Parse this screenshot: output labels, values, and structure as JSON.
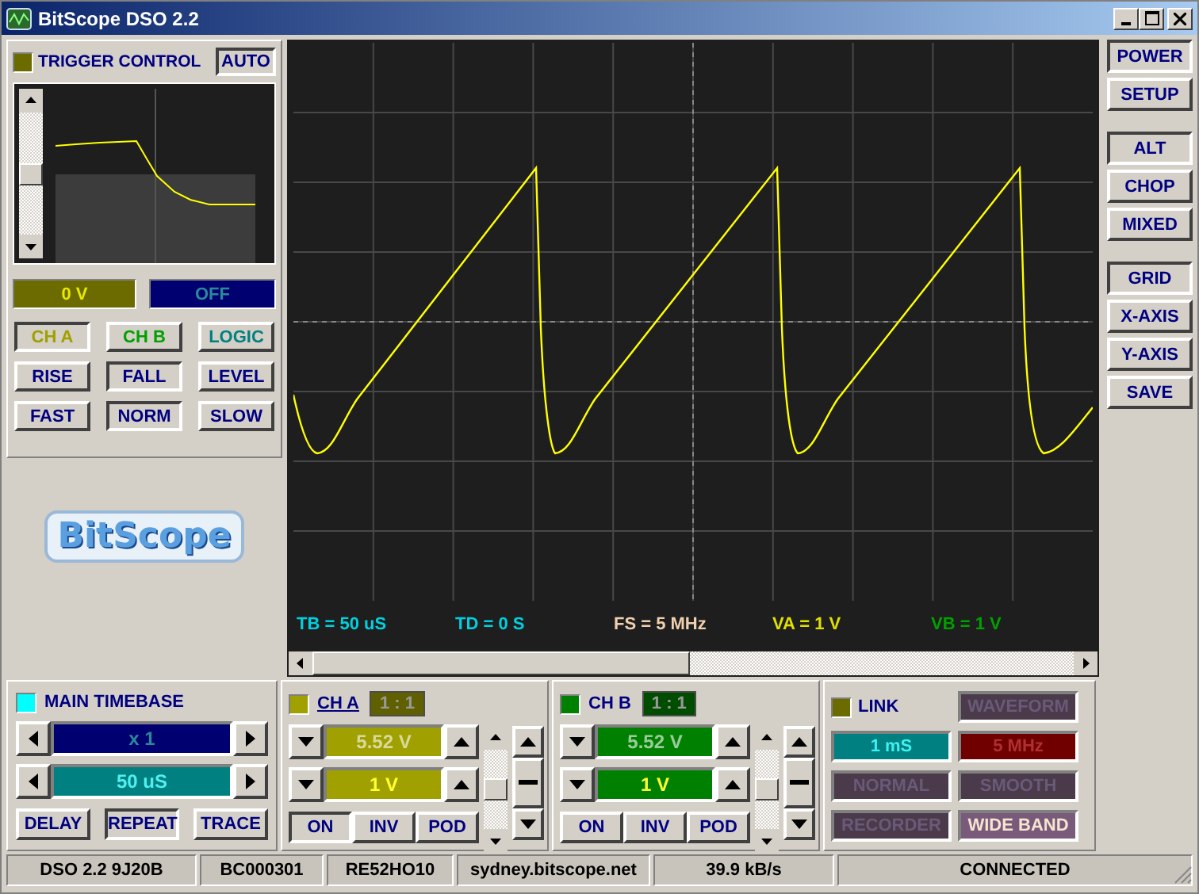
{
  "window": {
    "title": "BitScope DSO 2.2"
  },
  "trigger": {
    "title": "TRIGGER CONTROL",
    "auto": {
      "label": "AUTO",
      "pressed": true
    },
    "level_display": "0 V",
    "mode_display": "OFF",
    "buttons": [
      {
        "label": "CH A",
        "pressed": true,
        "color": "#a0a000"
      },
      {
        "label": "CH B",
        "pressed": false,
        "color": "#00a000"
      },
      {
        "label": "LOGIC",
        "pressed": false,
        "color": "#008080"
      },
      {
        "label": "RISE",
        "pressed": false,
        "color": "#000080"
      },
      {
        "label": "FALL",
        "pressed": true,
        "color": "#000080"
      },
      {
        "label": "LEVEL",
        "pressed": false,
        "color": "#000080"
      },
      {
        "label": "FAST",
        "pressed": false,
        "color": "#000080"
      },
      {
        "label": "NORM",
        "pressed": true,
        "color": "#000080"
      },
      {
        "label": "SLOW",
        "pressed": false,
        "color": "#000080"
      }
    ]
  },
  "logo": "BitScope",
  "scope": {
    "readouts": [
      {
        "text": "TB = 50 uS",
        "color": "#00d0e0"
      },
      {
        "text": "TD = 0 S",
        "color": "#00d0e0"
      },
      {
        "text": "FS = 5 MHz",
        "color": "#f0d0b0"
      },
      {
        "text": "VA = 1 V",
        "color": "#e0e000"
      },
      {
        "text": "VB = 1 V",
        "color": "#00a000"
      }
    ]
  },
  "side_buttons": [
    [
      {
        "label": "POWER",
        "pressed": true
      },
      {
        "label": "SETUP",
        "pressed": false
      }
    ],
    [
      {
        "label": "ALT",
        "pressed": true
      },
      {
        "label": "CHOP",
        "pressed": false
      },
      {
        "label": "MIXED",
        "pressed": false
      }
    ],
    [
      {
        "label": "GRID",
        "pressed": true
      },
      {
        "label": "X-AXIS",
        "pressed": false
      },
      {
        "label": "Y-AXIS",
        "pressed": false
      },
      {
        "label": "SAVE",
        "pressed": false
      }
    ]
  ],
  "timebase": {
    "title": "MAIN TIMEBASE",
    "zoom": "x 1",
    "time": "50 uS",
    "buttons": [
      {
        "label": "DELAY",
        "pressed": false
      },
      {
        "label": "REPEAT",
        "pressed": true
      },
      {
        "label": "TRACE",
        "pressed": false
      }
    ]
  },
  "channels": [
    {
      "name": "CH A",
      "underlined": true,
      "color": "#a0a000",
      "probe": "1 : 1",
      "offset": "5.52 V",
      "range": "1 V",
      "buttons": [
        {
          "label": "ON",
          "pressed": true
        },
        {
          "label": "INV",
          "pressed": false
        },
        {
          "label": "POD",
          "pressed": false
        }
      ]
    },
    {
      "name": "CH B",
      "underlined": false,
      "color": "#008000",
      "probe": "1 : 1",
      "offset": "5.52 V",
      "range": "1 V",
      "buttons": [
        {
          "label": "ON",
          "pressed": false
        },
        {
          "label": "INV",
          "pressed": false
        },
        {
          "label": "POD",
          "pressed": false
        }
      ]
    }
  ],
  "link": {
    "label": "LINK",
    "buttons": [
      {
        "label": "WAVEFORM",
        "kind": "mode",
        "selected": false
      },
      {
        "label": "1 mS",
        "kind": "duration",
        "selected": true
      },
      {
        "label": "5 MHz",
        "kind": "rate",
        "selected": false
      },
      {
        "label": "NORMAL",
        "kind": "mode",
        "selected": false
      },
      {
        "label": "SMOOTH",
        "kind": "mode",
        "selected": false
      },
      {
        "label": "RECORDER",
        "kind": "mode",
        "selected": false
      },
      {
        "label": "WIDE BAND",
        "kind": "mode",
        "selected": true
      }
    ]
  },
  "status_bar": [
    "DSO 2.2 9J20B",
    "BC000301",
    "RE52HO10",
    "sydney.bitscope.net",
    "39.9 kB/s",
    "CONNECTED"
  ]
}
